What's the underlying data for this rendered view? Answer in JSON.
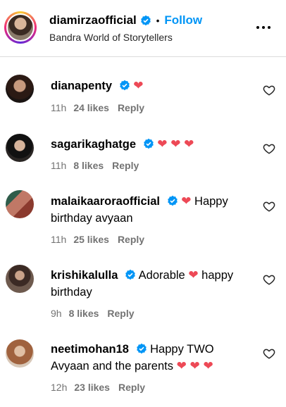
{
  "header": {
    "username": "diamirzaofficial",
    "separator": "•",
    "follow_label": "Follow",
    "subtitle": "Bandra World of Storytellers",
    "more_icon": "more-horizontal-icon"
  },
  "colors": {
    "accent": "#0095f6",
    "heart": "#ed4956",
    "muted": "#737373",
    "verified": "#0095f6"
  },
  "comments": [
    {
      "username": "dianapenty",
      "text": "",
      "hearts": "❤",
      "time": "11h",
      "likes": "24 likes",
      "reply": "Reply"
    },
    {
      "username": "sagarikaghatge",
      "text": "",
      "hearts": "❤ ❤ ❤",
      "time": "11h",
      "likes": "8 likes",
      "reply": "Reply"
    },
    {
      "username": "malaikaaroraofficial",
      "text_before": "",
      "hearts": "❤",
      "text": "Happy birthday avyaan",
      "time": "11h",
      "likes": "25 likes",
      "reply": "Reply"
    },
    {
      "username": "krishikalulla",
      "text_before": "Adorable",
      "hearts": "❤",
      "text": "happy birthday",
      "time": "9h",
      "likes": "8 likes",
      "reply": "Reply"
    },
    {
      "username": "neetimohan18",
      "text": "Happy TWO Avyaan and the parents",
      "hearts": "❤ ❤ ❤",
      "time": "12h",
      "likes": "23 likes",
      "reply": "Reply"
    }
  ]
}
